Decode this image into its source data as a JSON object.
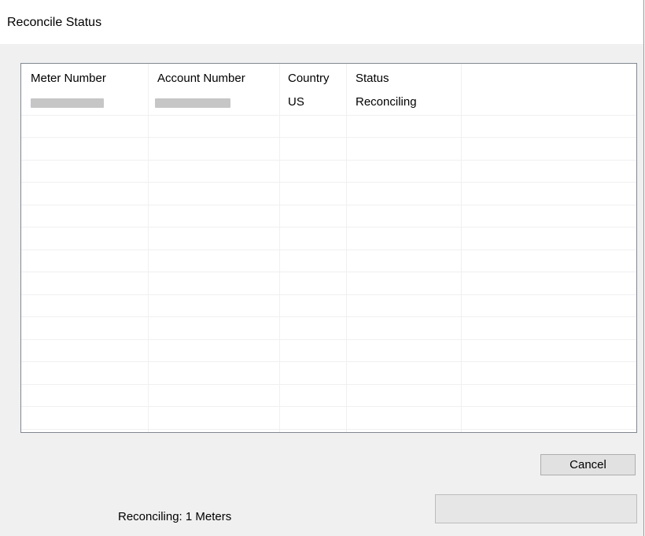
{
  "window": {
    "title": "Reconcile Status"
  },
  "table": {
    "columns": [
      "Meter Number",
      "Account Number",
      "Country",
      "Status"
    ],
    "rows": [
      {
        "meter_number": "",
        "account_number": "",
        "country": "US",
        "status": "Reconciling"
      }
    ]
  },
  "footer": {
    "cancel_label": "Cancel",
    "status_text": "Reconciling: 1 Meters",
    "progress": 0
  }
}
